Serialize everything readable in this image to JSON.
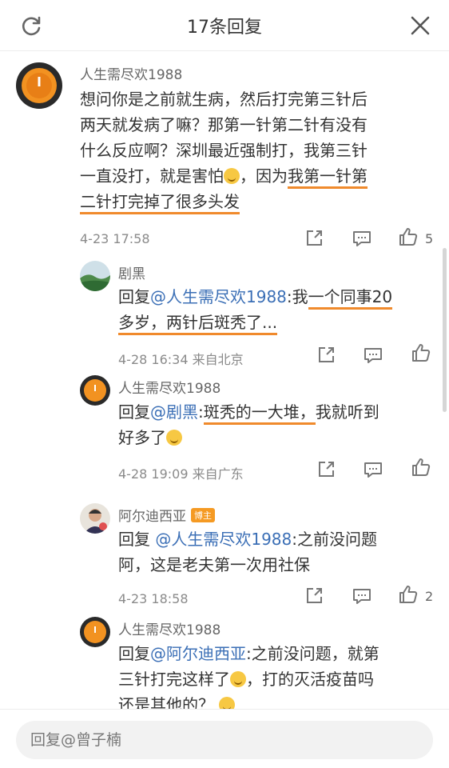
{
  "header": {
    "title": "17条回复"
  },
  "comments": [
    {
      "username": "人生需尽欢1988",
      "lines": [
        "想问你是之前就生病，然后打完第三针后",
        "两天就发病了嘛？那第一针第二针有没有",
        "什么反应啊？深圳最近强制打，我第三针"
      ],
      "line4a": "一直没打，就是害怕",
      "line4b": "，因为",
      "line4c": "我第一针第",
      "line5": "二针打完掉了很多头发",
      "time": "4-23 17:58",
      "likes": "5"
    },
    {
      "username": "剧黑",
      "reply_prefix": "回复",
      "mention": "@人生需尽欢1988",
      "colon": ":",
      "p1": "我",
      "p2": "一个同事20",
      "p3": "多岁，两针后斑秃了...",
      "time": "4-28 16:34",
      "location": "来自北京"
    },
    {
      "username": "人生需尽欢1988",
      "reply_prefix": "回复",
      "mention": "@剧黑",
      "colon": ":",
      "p1": "斑秃的一大堆，",
      "p2": "我就听到",
      "p3": "好多了",
      "time": "4-28 19:09",
      "location": "来自广东"
    },
    {
      "username": "阿尔迪西亚",
      "badge": "博主",
      "reply_prefix": "回复 ",
      "mention": "@人生需尽欢1988",
      "rest1": ":之前没问题",
      "line2": "阿，这是老夫第一次用社保",
      "time": "4-23 18:58",
      "likes": "2"
    },
    {
      "username": "人生需尽欢1988",
      "reply_prefix": "回复",
      "mention": "@阿尔迪西亚",
      "rest1": ":之前没问题，就第",
      "line2a": "三针打完这样了",
      "line2b": "，打的灭活疫苗吗",
      "line3": "还是其他的？"
    }
  ],
  "input": {
    "placeholder": "回复@曾子楠"
  },
  "colors": {
    "mention": "#3b6fb6",
    "underline": "#f08a2c",
    "badge": "#f59a23"
  }
}
